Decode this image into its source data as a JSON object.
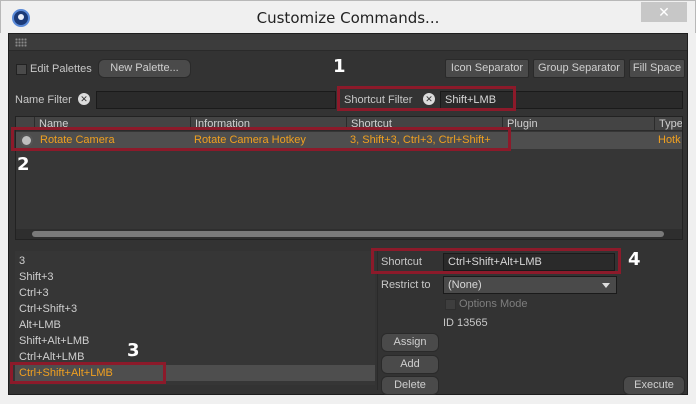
{
  "window": {
    "title": "Customize Commands...",
    "close_glyph": "✕"
  },
  "toolbar": {
    "edit_palettes_label": "Edit Palettes",
    "new_palette_label": "New Palette...",
    "icon_separator_label": "Icon Separator",
    "group_separator_label": "Group Separator",
    "fill_space_label": "Fill Space"
  },
  "filters": {
    "name_filter_label": "Name Filter",
    "name_filter_value": "",
    "shortcut_filter_label": "Shortcut Filter",
    "shortcut_filter_value": "Shift+LMB"
  },
  "table": {
    "columns": [
      "Name",
      "Information",
      "Shortcut",
      "Plugin",
      "Type"
    ],
    "rows": [
      {
        "name": "Rotate Camera",
        "information": "Rotate Camera Hotkey",
        "shortcut": "3, Shift+3, Ctrl+3, Ctrl+Shift+",
        "plugin": "",
        "type": "Hotk"
      }
    ]
  },
  "shortcut_list": {
    "items": [
      "3",
      "Shift+3",
      "Ctrl+3",
      "Ctrl+Shift+3",
      "Alt+LMB",
      "Shift+Alt+LMB",
      "Ctrl+Alt+LMB",
      "Ctrl+Shift+Alt+LMB"
    ],
    "selected_index": 7
  },
  "detail": {
    "shortcut_label": "Shortcut",
    "shortcut_value": "Ctrl+Shift+Alt+LMB",
    "restrict_label": "Restrict to",
    "restrict_value": "(None)",
    "options_mode_label": "Options Mode",
    "id_text": "ID 13565"
  },
  "actions": {
    "assign_label": "Assign",
    "add_label": "Add",
    "delete_label": "Delete",
    "execute_label": "Execute"
  },
  "annotations": [
    "1",
    "2",
    "3",
    "4"
  ],
  "colors": {
    "highlight_text": "#f0a020",
    "callout_border": "#8c1a2a",
    "panel_bg": "#333333"
  }
}
